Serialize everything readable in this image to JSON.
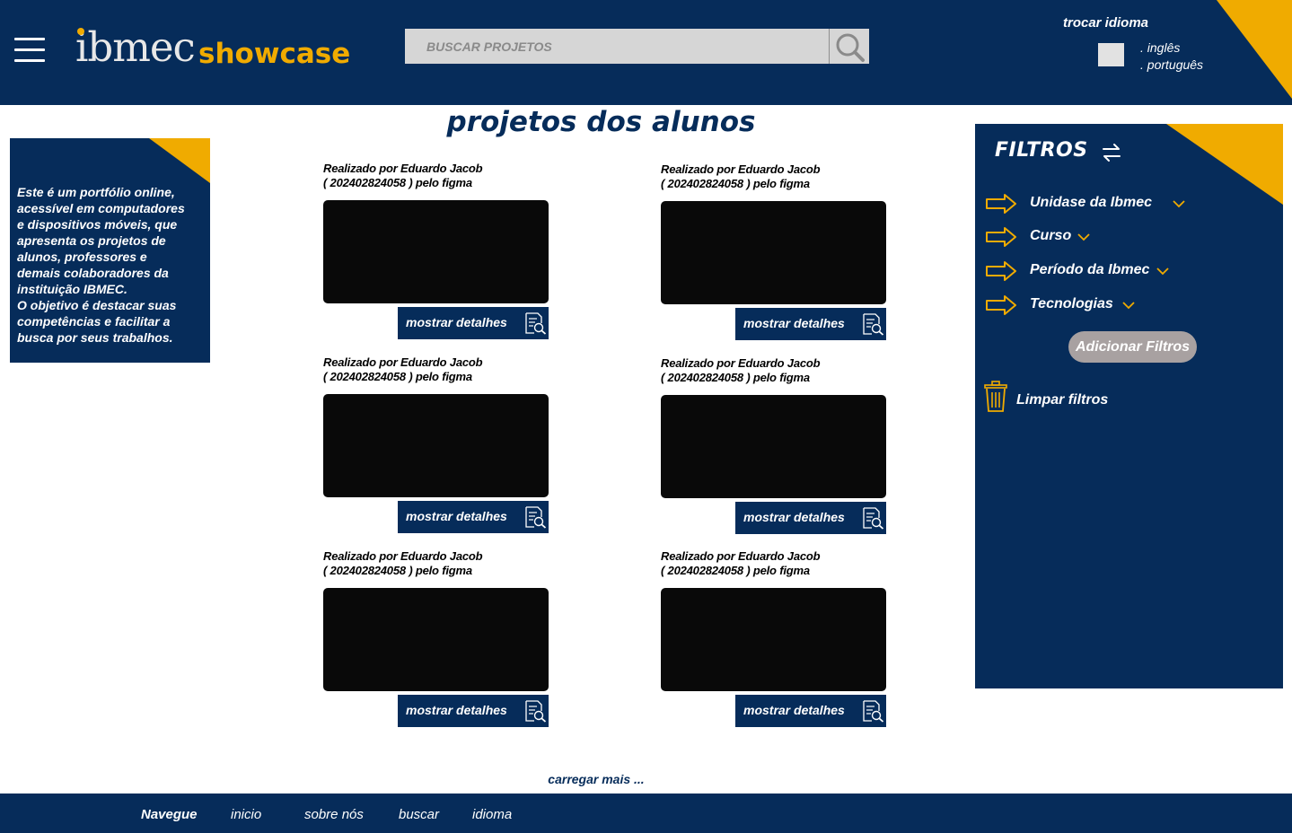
{
  "header": {
    "logo_ibmec": "ibmec",
    "logo_showcase": "showcase",
    "search_placeholder": "BUSCAR PROJETOS",
    "language": {
      "title": "trocar idioma",
      "options": [
        ". inglês",
        ". português"
      ]
    }
  },
  "main": {
    "title": "projetos dos alunos",
    "info_text": "Este é um portfólio online,\nacessível em computadores\n e dispositivos móveis, que\n apresenta os projetos de\n alunos, professores e\n demais colaboradores da\ninstituição IBMEC.\n O objetivo é destacar suas\n competências e facilitar a\n busca por seus trabalhos.",
    "projects": [
      {
        "caption": "Realizado por Eduardo Jacob\n ( 202402824058 ) pelo figma",
        "button": "mostrar detalhes"
      },
      {
        "caption": "Realizado por Eduardo Jacob\n ( 202402824058 ) pelo figma",
        "button": "mostrar detalhes"
      },
      {
        "caption": "Realizado por Eduardo Jacob\n ( 202402824058 ) pelo figma",
        "button": "mostrar detalhes"
      },
      {
        "caption": "Realizado por Eduardo Jacob\n ( 202402824058 ) pelo figma",
        "button": "mostrar detalhes"
      },
      {
        "caption": "Realizado por Eduardo Jacob\n ( 202402824058 ) pelo figma",
        "button": "mostrar detalhes"
      },
      {
        "caption": "Realizado por Eduardo Jacob\n ( 202402824058 ) pelo figma",
        "button": "mostrar detalhes"
      }
    ],
    "load_more": "carregar mais ..."
  },
  "filters": {
    "title": "FILTROS",
    "items": [
      {
        "label": "Unidase da Ibmec"
      },
      {
        "label": "Curso"
      },
      {
        "label": "Período da Ibmec"
      },
      {
        "label": "Tecnologias"
      }
    ],
    "add_button": "Adicionar  Filtros",
    "clear_label": "Limpar filtros"
  },
  "footer": {
    "title": "Navegue",
    "links": [
      "inicio",
      "sobre nós",
      "buscar",
      "idioma"
    ]
  },
  "colors": {
    "navy": "#062c5a",
    "accent": "#f0ab00",
    "thumbnail": "#090909",
    "add_filters_bg": "#a8a1a1"
  },
  "icons": {
    "menu": "hamburger-icon",
    "search": "search-icon",
    "details": "document-search-icon",
    "swap": "swap-arrows-icon",
    "filter_bullet": "arrow-right-icon",
    "dropdown": "chevron-down-icon",
    "clear": "trash-icon"
  }
}
